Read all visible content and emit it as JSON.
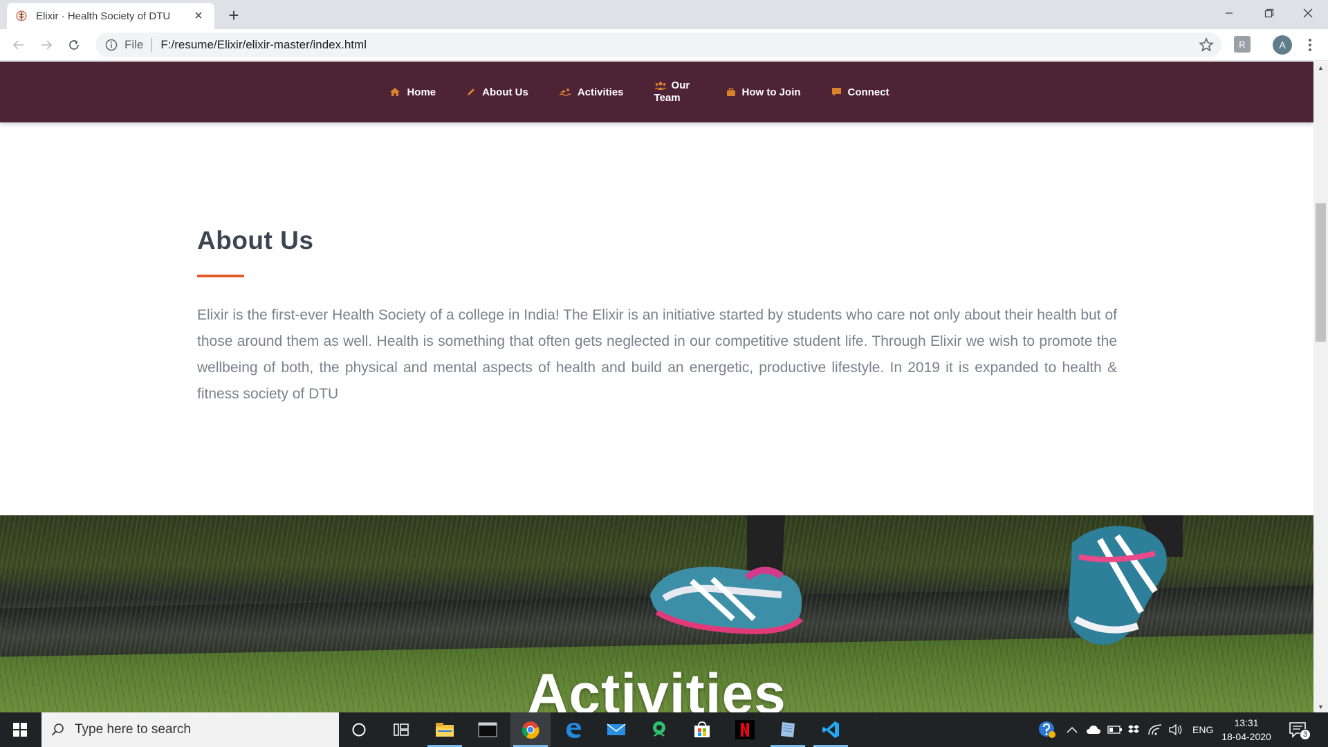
{
  "browser": {
    "tab_title": "Elixir · Health Society of DTU",
    "omnibox_scheme_label": "File",
    "url": "F:/resume/Elixir/elixir-master/index.html",
    "profile_initial": "A",
    "extension_label": "R"
  },
  "site_nav": {
    "items": [
      {
        "label": "Home",
        "icon": "home-icon"
      },
      {
        "label": "About Us",
        "icon": "pencil-icon"
      },
      {
        "label": "Activities",
        "icon": "swimmer-icon"
      }
    ],
    "team": {
      "line1": "Our",
      "line2": "Team",
      "icon": "users-icon"
    },
    "items_after": [
      {
        "label": "How to Join",
        "icon": "briefcase-icon"
      },
      {
        "label": "Connect",
        "icon": "comment-icon"
      }
    ],
    "background": "#4e2336",
    "icon_color": "#d9822b"
  },
  "about": {
    "heading": "About Us",
    "accent": "#e25c2b",
    "body": "Elixir is the first-ever Health Society of a college in India! The Elixir is an initiative started by students who care not only about their health but of those around them as well. Health is something that often gets neglected in our competitive student life. Through Elixir we wish to promote the wellbeing of both, the physical and mental aspects of health and build an energetic, productive lifestyle. In 2019 it is expanded to health & fitness society of DTU"
  },
  "activities_hero": {
    "title": "Activities"
  },
  "taskbar": {
    "search_placeholder": "Type here to search",
    "language": "ENG",
    "time": "13:31",
    "date": "18-04-2020",
    "notification_count": "3"
  }
}
